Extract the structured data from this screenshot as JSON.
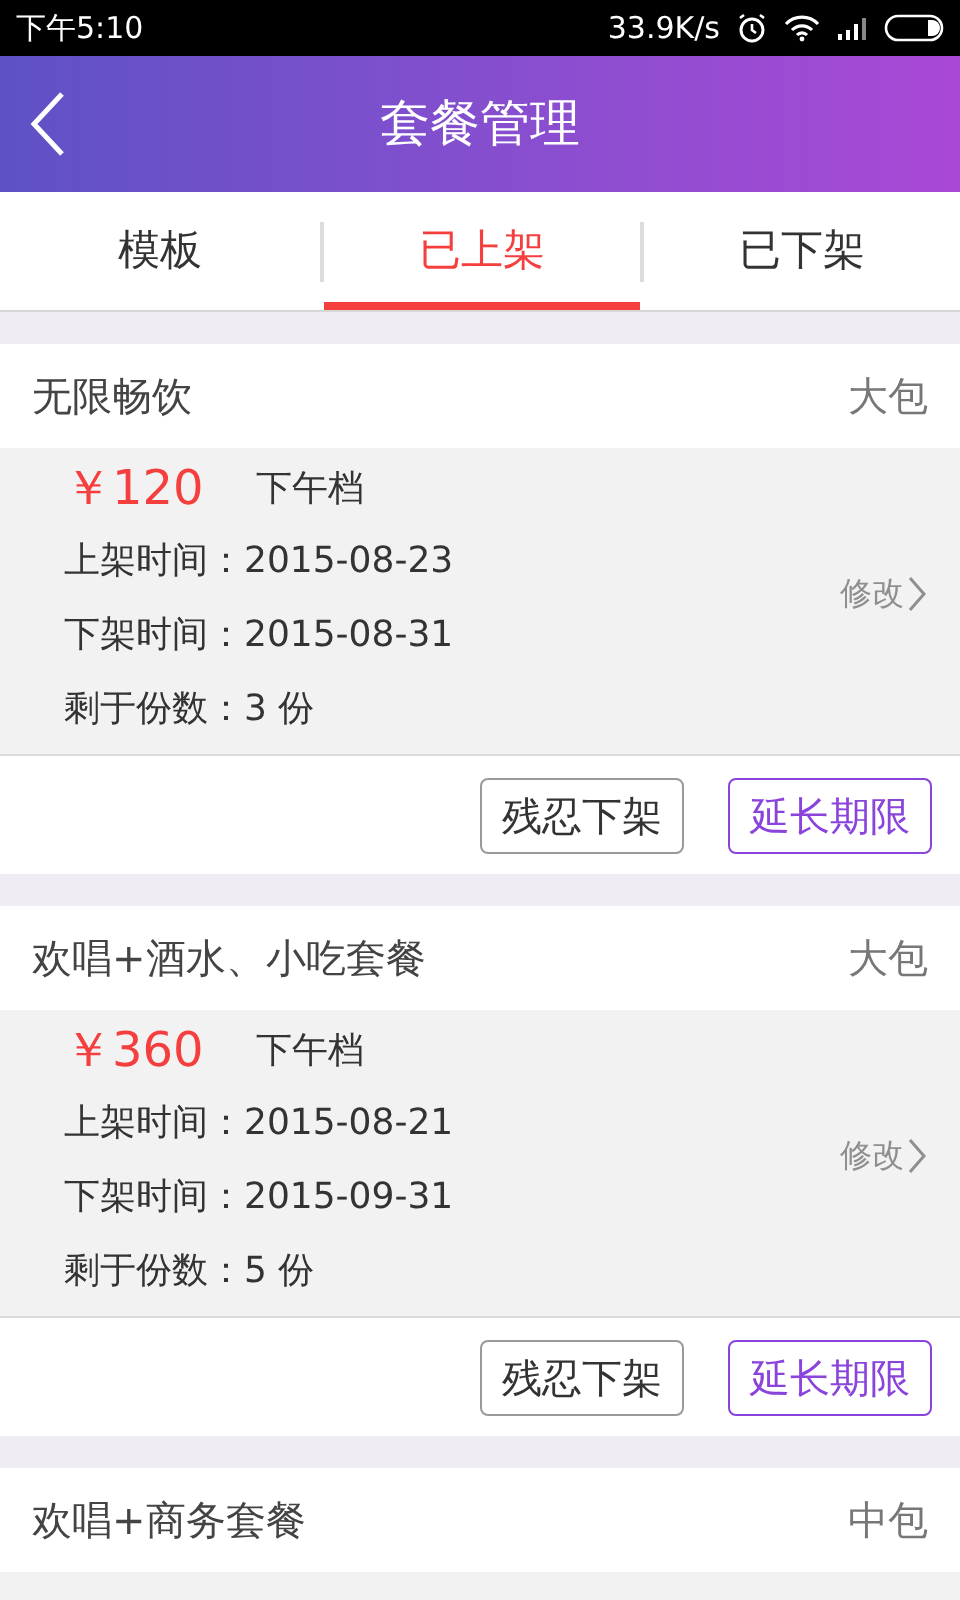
{
  "status_bar": {
    "time": "下午5:10",
    "speed": "33.9K/s"
  },
  "header": {
    "title": "套餐管理"
  },
  "tabs": [
    {
      "label": "模板",
      "selected": false
    },
    {
      "label": "已上架",
      "selected": true
    },
    {
      "label": "已下架",
      "selected": false
    }
  ],
  "packages": [
    {
      "name": "无限畅饮",
      "room": "大包",
      "price": "￥120",
      "slot": "下午档",
      "on_shelf": "上架时间：2015-08-23",
      "off_shelf": "下架时间：2015-08-31",
      "remaining": "剩于份数：3 份",
      "edit": "修改",
      "buttons": [
        "残忍下架",
        "延长期限"
      ]
    },
    {
      "name": "欢唱+酒水、小吃套餐",
      "room": "大包",
      "price": "￥360",
      "slot": "下午档",
      "on_shelf": "上架时间：2015-08-21",
      "off_shelf": "下架时间：2015-09-31",
      "remaining": "剩于份数：5 份",
      "edit": "修改",
      "buttons": [
        "残忍下架",
        "延长期限"
      ]
    },
    {
      "name": "欢唱+商务套餐",
      "room": "中包"
    }
  ]
}
